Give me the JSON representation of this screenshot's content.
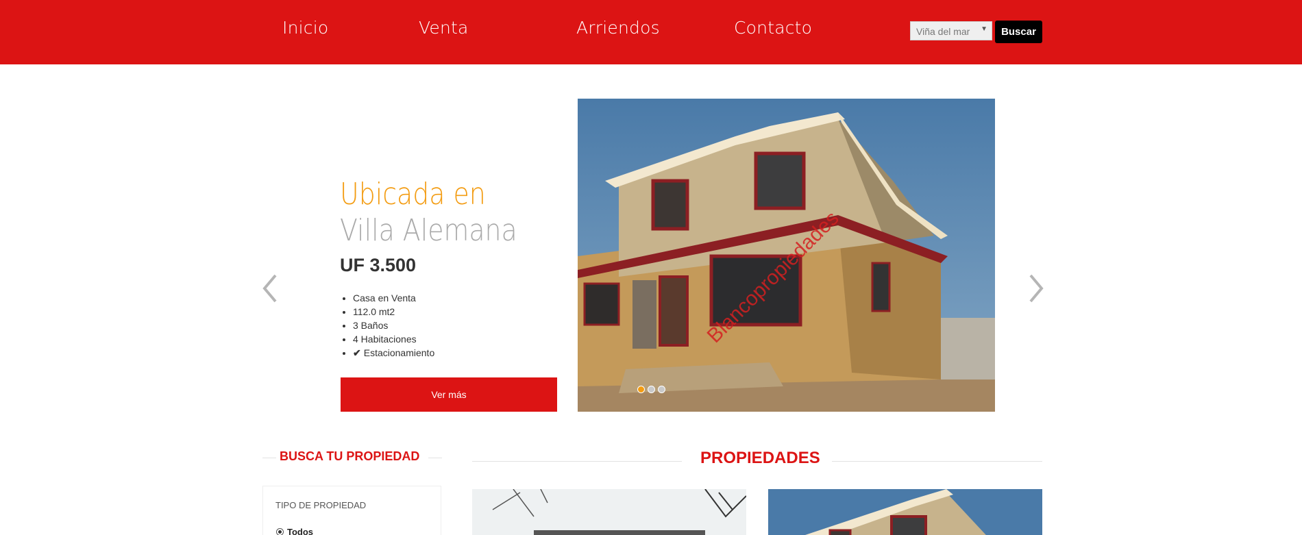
{
  "nav": {
    "items": [
      {
        "label": "Inicio"
      },
      {
        "label": "Venta"
      },
      {
        "label": "Arriendos"
      },
      {
        "label": "Contacto"
      }
    ],
    "city_select": "Viña del mar",
    "search_label": "Buscar"
  },
  "hero": {
    "title_line1": "Ubicada en",
    "title_line2": "Villa Alemana",
    "price": "UF 3.500",
    "features": [
      "Casa en Venta",
      "112.0 mt2",
      "3 Baños",
      "4 Habitaciones",
      "Estacionamiento"
    ],
    "cta_label": "Ver más",
    "watermark": "Blancopropiedades",
    "slides_total": 3,
    "active_slide": 1
  },
  "sidebar": {
    "heading": "BUSCA TU PROPIEDAD",
    "filter_label": "TIPO DE PROPIEDAD",
    "radio_option": "Todos"
  },
  "main": {
    "heading": "PROPIEDADES"
  },
  "colors": {
    "brand_red": "#dc1414",
    "accent_orange": "#f39c12",
    "black_button": "#000000"
  }
}
